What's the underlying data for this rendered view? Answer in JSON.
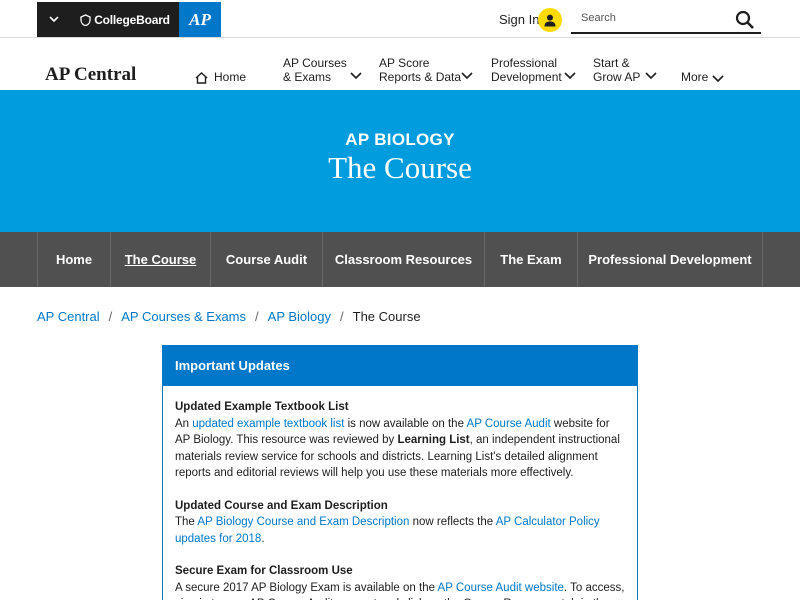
{
  "topbar": {
    "cb_logo": "CollegeBoard",
    "ap_logo": "AP",
    "signin": "Sign In",
    "search_placeholder": "Search"
  },
  "nav": {
    "brand": "AP Central",
    "home": "Home",
    "courses_l1": "AP Courses",
    "courses_l2": "& Exams",
    "scores_l1": "AP Score",
    "scores_l2": "Reports & Data",
    "pd_l1": "Professional",
    "pd_l2": "Development",
    "start_l1": "Start &",
    "start_l2": "Grow AP",
    "more": "More"
  },
  "hero": {
    "subtitle": "AP BIOLOGY",
    "title": "The Course"
  },
  "subnav": {
    "tabs": [
      "Home",
      "The Course",
      "Course Audit",
      "Classroom Resources",
      "The Exam",
      "Professional Development"
    ]
  },
  "breadcrumb": {
    "items": [
      "AP Central",
      "AP Courses & Exams",
      "AP Biology"
    ],
    "current": "The Course",
    "sep": "/"
  },
  "updates": {
    "header": "Important Updates",
    "s1": {
      "title": "Updated Example Textbook List",
      "t1": "An ",
      "l1": "updated example textbook list",
      "t2": " is now available on the ",
      "l2": "AP Course Audit",
      "t3": " website for AP Biology. This resource was reviewed by ",
      "b1": "Learning List",
      "t4": ", an independent instructional materials review service for schools and districts. Learning List's detailed alignment reports and editorial reviews will help you use these materials more effectively."
    },
    "s2": {
      "title": "Updated Course and Exam Description",
      "t1": "The ",
      "l1": "AP Biology Course and Exam Description",
      "t2": " now reflects the ",
      "l2": "AP Calculator Policy updates for 2018",
      "t3": "."
    },
    "s3": {
      "title": "Secure Exam for Classroom Use",
      "t1": "A secure 2017 AP Biology Exam is available on the ",
      "l1": "AP Course Audit website",
      "t2": ". To access, sign in to your AP Course Audit account and click on the Course Resources tab in the"
    }
  }
}
